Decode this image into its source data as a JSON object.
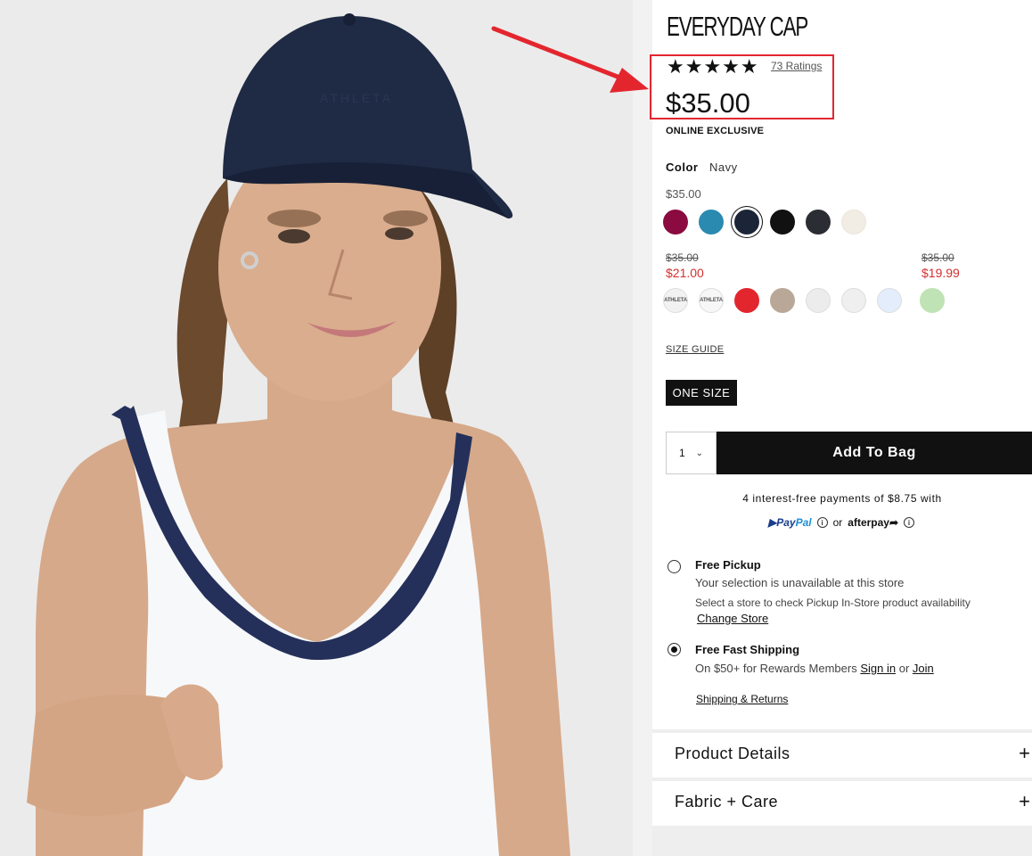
{
  "product": {
    "title": "EVERYDAY CAP",
    "stars": "★★★★★",
    "ratings_link": "73 Ratings",
    "price": "$35.00",
    "badge": "ONLINE EXCLUSIVE",
    "image_brand_text": "ATHLETA"
  },
  "color": {
    "label": "Color",
    "value": "Navy",
    "group1_price": "$35.00",
    "group1_swatches": [
      {
        "name": "berry",
        "hex": "#8b0a3f"
      },
      {
        "name": "teal-heather",
        "hex": "#2a8ab0"
      },
      {
        "name": "navy",
        "hex": "#1c2438",
        "selected": true
      },
      {
        "name": "black",
        "hex": "#111111"
      },
      {
        "name": "charcoal",
        "hex": "#2a2d33"
      },
      {
        "name": "cream",
        "hex": "#f1ece4"
      }
    ],
    "group2_original": "$35.00",
    "group2_sale": "$21.00",
    "group3_original": "$35.00",
    "group3_sale": "$19.99",
    "swatch_logo_text": "ATHLETA",
    "group2_swatches": [
      {
        "name": "white-logo-1",
        "hex": "#f2f2f2"
      },
      {
        "name": "white-logo-2",
        "hex": "#f7f7f7"
      },
      {
        "name": "red",
        "hex": "#e3262e"
      },
      {
        "name": "taupe",
        "hex": "#b9a898"
      },
      {
        "name": "light-grey",
        "hex": "#ececec"
      },
      {
        "name": "off-white",
        "hex": "#efefef"
      },
      {
        "name": "light-blue",
        "hex": "#e3edfb"
      }
    ],
    "group3_swatches": [
      {
        "name": "mint-green",
        "hex": "#bfe3b4"
      }
    ]
  },
  "size": {
    "guide_link": "SIZE GUIDE",
    "selected": "ONE SIZE"
  },
  "purchase": {
    "quantity": "1",
    "add_to_bag": "Add To Bag",
    "installments": "4 interest-free payments of $8.75 with",
    "paypal_a": "Pay",
    "paypal_b": "Pal",
    "or": "or",
    "afterpay": "afterpay"
  },
  "fulfillment": {
    "pickup_title": "Free Pickup",
    "pickup_status": "Your selection is unavailable at this store",
    "pickup_hint": "Select a store to check Pickup In-Store product availability",
    "change_store": "Change Store",
    "shipping_title": "Free Fast Shipping",
    "shipping_text": "On $50+ for Rewards Members",
    "sign_in": "Sign in",
    "or": "or",
    "join": "Join",
    "shipping_returns": "Shipping & Returns"
  },
  "accordions": [
    {
      "label": "Product Details",
      "icon": "+"
    },
    {
      "label": "Fabric + Care",
      "icon": "+"
    }
  ],
  "annotation": {
    "arrow_color": "#e3262e",
    "box_color": "#e3262e"
  }
}
